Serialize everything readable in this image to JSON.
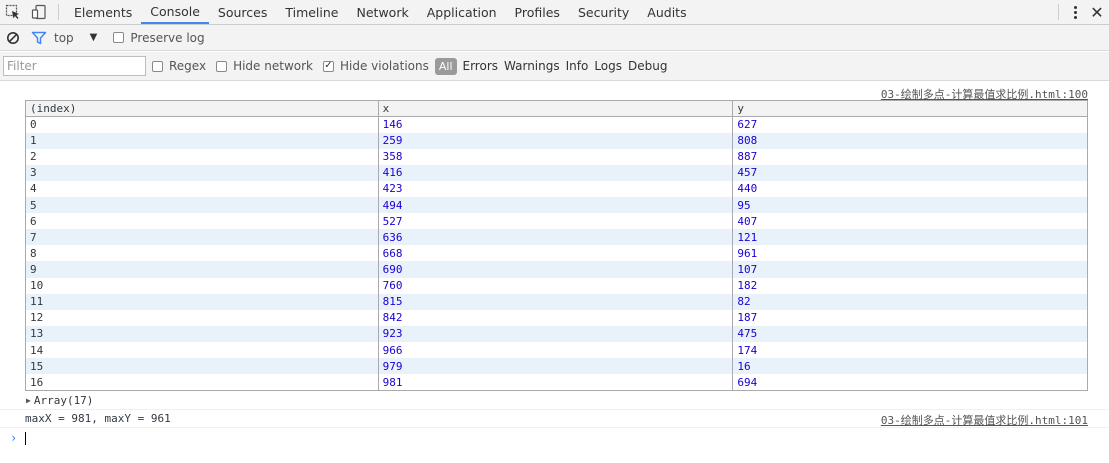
{
  "tabbar": {
    "tabs": [
      {
        "label": "Elements"
      },
      {
        "label": "Console"
      },
      {
        "label": "Sources"
      },
      {
        "label": "Timeline"
      },
      {
        "label": "Network"
      },
      {
        "label": "Application"
      },
      {
        "label": "Profiles"
      },
      {
        "label": "Security"
      },
      {
        "label": "Audits"
      }
    ],
    "selected": "Console"
  },
  "toolbar": {
    "context": "top",
    "preserve_log": {
      "label": "Preserve log",
      "checked": false
    }
  },
  "filterbar": {
    "placeholder": "Filter",
    "regex": {
      "label": "Regex",
      "checked": false
    },
    "hide_network": {
      "label": "Hide network",
      "checked": false
    },
    "hide_violations": {
      "label": "Hide violations",
      "checked": true
    },
    "levels": {
      "all": "All",
      "errors": "Errors",
      "warnings": "Warnings",
      "info": "Info",
      "logs": "Logs",
      "debug": "Debug"
    }
  },
  "console": {
    "table_source": "03-绘制多点-计算最值求比例.html:100",
    "columns": {
      "index": "(index)",
      "x": "x",
      "y": "y"
    },
    "rows": [
      {
        "index": "0",
        "x": "146",
        "y": "627"
      },
      {
        "index": "1",
        "x": "259",
        "y": "808"
      },
      {
        "index": "2",
        "x": "358",
        "y": "887"
      },
      {
        "index": "3",
        "x": "416",
        "y": "457"
      },
      {
        "index": "4",
        "x": "423",
        "y": "440"
      },
      {
        "index": "5",
        "x": "494",
        "y": "95"
      },
      {
        "index": "6",
        "x": "527",
        "y": "407"
      },
      {
        "index": "7",
        "x": "636",
        "y": "121"
      },
      {
        "index": "8",
        "x": "668",
        "y": "961"
      },
      {
        "index": "9",
        "x": "690",
        "y": "107"
      },
      {
        "index": "10",
        "x": "760",
        "y": "182"
      },
      {
        "index": "11",
        "x": "815",
        "y": "82"
      },
      {
        "index": "12",
        "x": "842",
        "y": "187"
      },
      {
        "index": "13",
        "x": "923",
        "y": "475"
      },
      {
        "index": "14",
        "x": "966",
        "y": "174"
      },
      {
        "index": "15",
        "x": "979",
        "y": "16"
      },
      {
        "index": "16",
        "x": "981",
        "y": "694"
      }
    ],
    "array_label": "Array(17)",
    "log_message": "maxX = 981, maxY = 961",
    "log_source": "03-绘制多点-计算最值求比例.html:101"
  }
}
